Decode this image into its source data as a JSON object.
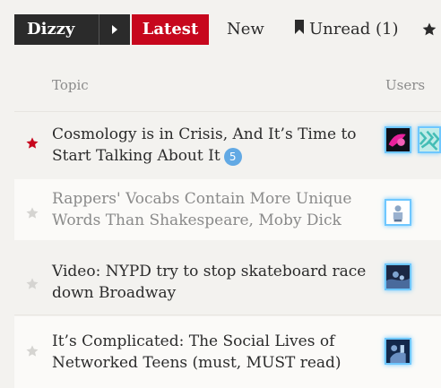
{
  "nav": {
    "category_label": "Dizzy",
    "tabs": {
      "latest": "Latest",
      "new": "New",
      "unread": "Unread (1)"
    }
  },
  "list": {
    "headers": {
      "topic": "Topic",
      "users": "Users"
    },
    "rows": [
      {
        "title": "Cosmology is in Crisis, And It’s Time to Start Talking About It",
        "badge": "5",
        "starred": true
      },
      {
        "title": "Rappers' Vocabs Contain More Unique Words Than Shakespeare, Moby Dick",
        "starred": false
      },
      {
        "title": "Video: NYPD try to stop skateboard race down Broadway",
        "starred": false
      },
      {
        "title": "It’s Complicated: The Social Lives of Networked Teens (must, MUST read)",
        "starred": false
      }
    ]
  },
  "colors": {
    "accent": "#c7071d",
    "badge": "#62a9e4",
    "avatar_glow": "#6ec7ff"
  }
}
